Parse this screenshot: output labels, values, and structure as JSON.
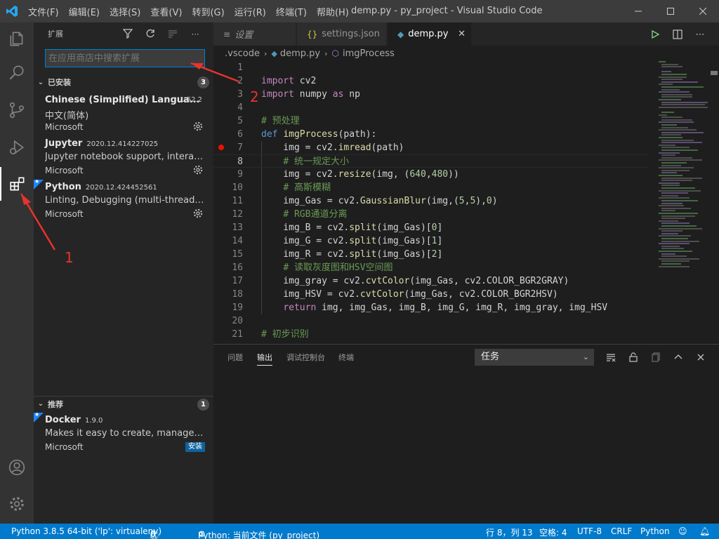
{
  "title_bar": {
    "menu": [
      "文件(F)",
      "编辑(E)",
      "选择(S)",
      "查看(V)",
      "转到(G)",
      "运行(R)",
      "终端(T)",
      "帮助(H)"
    ],
    "window_title": "demp.py - py_project - Visual Studio Code"
  },
  "sidebar": {
    "title": "扩展",
    "search_placeholder": "在应用商店中搜索扩展",
    "installed": {
      "label": "已安装",
      "count": "3",
      "items": [
        {
          "name": "Chinese (Simplified) Langua...",
          "version": "1.52.2",
          "desc": "中文(简体)",
          "publisher": "Microsoft"
        },
        {
          "name": "Jupyter",
          "version": "2020.12.414227025",
          "desc": "Jupyter notebook support, interactive ...",
          "publisher": "Microsoft"
        },
        {
          "name": "Python",
          "version": "2020.12.424452561",
          "desc": "Linting, Debugging (multi-threaded, r...",
          "publisher": "Microsoft"
        }
      ]
    },
    "recommended": {
      "label": "推荐",
      "count": "1",
      "items": [
        {
          "name": "Docker",
          "version": "1.9.0",
          "desc": "Makes it easy to create, manage, and ...",
          "publisher": "Microsoft",
          "install_label": "安装"
        }
      ]
    }
  },
  "tabs": [
    {
      "label": "设置",
      "active": false
    },
    {
      "label": "settings.json",
      "icon": "{}",
      "active": false
    },
    {
      "label": "demp.py",
      "active": true
    }
  ],
  "breadcrumbs": [
    ".vscode",
    "demp.py",
    "imgProcess"
  ],
  "editor": {
    "current_line": 8,
    "breakpoint_line": 7,
    "lines": [
      {
        "n": "1",
        "code": ""
      },
      {
        "n": "2",
        "code": "import cv2"
      },
      {
        "n": "3",
        "code": "import numpy as np"
      },
      {
        "n": "4",
        "code": ""
      },
      {
        "n": "5",
        "code": "# 预处理"
      },
      {
        "n": "6",
        "code": "def imgProcess(path):"
      },
      {
        "n": "7",
        "code": "    img = cv2.imread(path)"
      },
      {
        "n": "8",
        "code": "    # 统一规定大小"
      },
      {
        "n": "9",
        "code": "    img = cv2.resize(img, (640,480))"
      },
      {
        "n": "10",
        "code": "    # 高斯模糊"
      },
      {
        "n": "11",
        "code": "    img_Gas = cv2.GaussianBlur(img,(5,5),0)"
      },
      {
        "n": "12",
        "code": "    # RGB通道分离"
      },
      {
        "n": "13",
        "code": "    img_B = cv2.split(img_Gas)[0]"
      },
      {
        "n": "14",
        "code": "    img_G = cv2.split(img_Gas)[1]"
      },
      {
        "n": "15",
        "code": "    img_R = cv2.split(img_Gas)[2]"
      },
      {
        "n": "16",
        "code": "    # 读取灰度图和HSV空间图"
      },
      {
        "n": "17",
        "code": "    img_gray = cv2.cvtColor(img_Gas, cv2.COLOR_BGR2GRAY)"
      },
      {
        "n": "18",
        "code": "    img_HSV = cv2.cvtColor(img_Gas, cv2.COLOR_BGR2HSV)"
      },
      {
        "n": "19",
        "code": "    return img, img_Gas, img_B, img_G, img_R, img_gray, img_HSV"
      },
      {
        "n": "20",
        "code": ""
      },
      {
        "n": "21",
        "code": "# 初步识别"
      }
    ]
  },
  "panel": {
    "tabs": [
      "问题",
      "输出",
      "调试控制台",
      "终端"
    ],
    "active_tab": "输出",
    "task_select": "任务"
  },
  "status_bar": {
    "python": "Python 3.8.5 64-bit ('lp': virtualenv)",
    "errors": "0",
    "warnings": "0",
    "run": "Python: 当前文件 (py_project)",
    "position": "行 8，列 13",
    "spaces": "空格: 4",
    "encoding": "UTF-8",
    "eol": "CRLF",
    "language": "Python"
  },
  "annotations": {
    "one": "1",
    "two": "2"
  },
  "colors": {
    "accent": "#007acc",
    "annotation": "#e8332c",
    "breakpoint": "#e51400"
  }
}
